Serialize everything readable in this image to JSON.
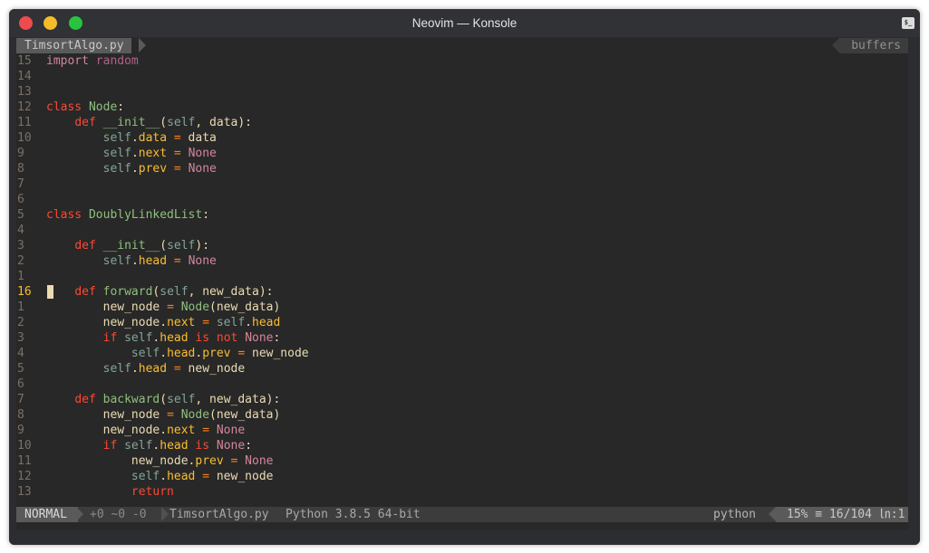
{
  "window": {
    "title": "Neovim — Konsole",
    "terminal_icon": "$_",
    "colors": {
      "close": "#ee4b4f",
      "minimize": "#f4bc28",
      "maximize": "#2ac33f"
    }
  },
  "tabline": {
    "active_tab": "TimsortAlgo.py",
    "buffers_label": "buffers"
  },
  "code": {
    "lines": [
      {
        "n": "15",
        "tokens": [
          [
            "kw2",
            "import"
          ],
          [
            "id",
            " "
          ],
          [
            "mod",
            "random"
          ]
        ]
      },
      {
        "n": "14",
        "tokens": []
      },
      {
        "n": "13",
        "tokens": []
      },
      {
        "n": "12",
        "tokens": [
          [
            "kw",
            "class"
          ],
          [
            "id",
            " "
          ],
          [
            "cls",
            "Node"
          ],
          [
            "id",
            ":"
          ]
        ]
      },
      {
        "n": "11",
        "tokens": [
          [
            "id",
            "    "
          ],
          [
            "kw",
            "def"
          ],
          [
            "id",
            " "
          ],
          [
            "cls",
            "__init__"
          ],
          [
            "id",
            "("
          ],
          [
            "self",
            "self"
          ],
          [
            "id",
            ", data):"
          ]
        ]
      },
      {
        "n": "10",
        "tokens": [
          [
            "id",
            "        "
          ],
          [
            "self",
            "self"
          ],
          [
            "id",
            "."
          ],
          [
            "attr",
            "data"
          ],
          [
            "id",
            " "
          ],
          [
            "op",
            "="
          ],
          [
            "id",
            " data"
          ]
        ]
      },
      {
        "n": "9",
        "tokens": [
          [
            "id",
            "        "
          ],
          [
            "self",
            "self"
          ],
          [
            "id",
            "."
          ],
          [
            "attr",
            "next"
          ],
          [
            "id",
            " "
          ],
          [
            "op",
            "="
          ],
          [
            "id",
            " "
          ],
          [
            "pink",
            "None"
          ]
        ]
      },
      {
        "n": "8",
        "tokens": [
          [
            "id",
            "        "
          ],
          [
            "self",
            "self"
          ],
          [
            "id",
            "."
          ],
          [
            "attr",
            "prev"
          ],
          [
            "id",
            " "
          ],
          [
            "op",
            "="
          ],
          [
            "id",
            " "
          ],
          [
            "pink",
            "None"
          ]
        ]
      },
      {
        "n": "7",
        "tokens": []
      },
      {
        "n": "6",
        "tokens": []
      },
      {
        "n": "5",
        "tokens": [
          [
            "kw",
            "class"
          ],
          [
            "id",
            " "
          ],
          [
            "cls",
            "DoublyLinkedList"
          ],
          [
            "id",
            ":"
          ]
        ]
      },
      {
        "n": "4",
        "tokens": []
      },
      {
        "n": "3",
        "tokens": [
          [
            "id",
            "    "
          ],
          [
            "kw",
            "def"
          ],
          [
            "id",
            " "
          ],
          [
            "cls",
            "__init__"
          ],
          [
            "id",
            "("
          ],
          [
            "self",
            "self"
          ],
          [
            "id",
            "):"
          ]
        ]
      },
      {
        "n": "2",
        "tokens": [
          [
            "id",
            "        "
          ],
          [
            "self",
            "self"
          ],
          [
            "id",
            "."
          ],
          [
            "attr",
            "head"
          ],
          [
            "id",
            " "
          ],
          [
            "op",
            "="
          ],
          [
            "id",
            " "
          ],
          [
            "pink",
            "None"
          ]
        ]
      },
      {
        "n": "1",
        "tokens": []
      },
      {
        "n": "16",
        "current": true,
        "tokens": [
          [
            "id",
            "    "
          ],
          [
            "kw",
            "def"
          ],
          [
            "id",
            " "
          ],
          [
            "cls",
            "forward"
          ],
          [
            "id",
            "("
          ],
          [
            "self",
            "self"
          ],
          [
            "id",
            ", new_data):"
          ]
        ]
      },
      {
        "n": "1",
        "tokens": [
          [
            "id",
            "        new_node "
          ],
          [
            "op",
            "="
          ],
          [
            "id",
            " "
          ],
          [
            "cls",
            "Node"
          ],
          [
            "id",
            "(new_data)"
          ]
        ]
      },
      {
        "n": "2",
        "tokens": [
          [
            "id",
            "        new_node."
          ],
          [
            "attr",
            "next"
          ],
          [
            "id",
            " "
          ],
          [
            "op",
            "="
          ],
          [
            "id",
            " "
          ],
          [
            "self",
            "self"
          ],
          [
            "id",
            "."
          ],
          [
            "attr",
            "head"
          ]
        ]
      },
      {
        "n": "3",
        "tokens": [
          [
            "id",
            "        "
          ],
          [
            "kw",
            "if"
          ],
          [
            "id",
            " "
          ],
          [
            "self",
            "self"
          ],
          [
            "id",
            "."
          ],
          [
            "attr",
            "head"
          ],
          [
            "id",
            " "
          ],
          [
            "kw",
            "is"
          ],
          [
            "id",
            " "
          ],
          [
            "kw",
            "not"
          ],
          [
            "id",
            " "
          ],
          [
            "pink",
            "None"
          ],
          [
            "id",
            ":"
          ]
        ]
      },
      {
        "n": "4",
        "tokens": [
          [
            "id",
            "            "
          ],
          [
            "self",
            "self"
          ],
          [
            "id",
            "."
          ],
          [
            "attr",
            "head"
          ],
          [
            "id",
            "."
          ],
          [
            "attr",
            "prev"
          ],
          [
            "id",
            " "
          ],
          [
            "op",
            "="
          ],
          [
            "id",
            " new_node"
          ]
        ]
      },
      {
        "n": "5",
        "tokens": [
          [
            "id",
            "        "
          ],
          [
            "self",
            "self"
          ],
          [
            "id",
            "."
          ],
          [
            "attr",
            "head"
          ],
          [
            "id",
            " "
          ],
          [
            "op",
            "="
          ],
          [
            "id",
            " new_node"
          ]
        ]
      },
      {
        "n": "6",
        "tokens": []
      },
      {
        "n": "7",
        "tokens": [
          [
            "id",
            "    "
          ],
          [
            "kw",
            "def"
          ],
          [
            "id",
            " "
          ],
          [
            "cls",
            "backward"
          ],
          [
            "id",
            "("
          ],
          [
            "self",
            "self"
          ],
          [
            "id",
            ", new_data):"
          ]
        ]
      },
      {
        "n": "8",
        "tokens": [
          [
            "id",
            "        new_node "
          ],
          [
            "op",
            "="
          ],
          [
            "id",
            " "
          ],
          [
            "cls",
            "Node"
          ],
          [
            "id",
            "(new_data)"
          ]
        ]
      },
      {
        "n": "9",
        "tokens": [
          [
            "id",
            "        new_node."
          ],
          [
            "attr",
            "next"
          ],
          [
            "id",
            " "
          ],
          [
            "op",
            "="
          ],
          [
            "id",
            " "
          ],
          [
            "pink",
            "None"
          ]
        ]
      },
      {
        "n": "10",
        "tokens": [
          [
            "id",
            "        "
          ],
          [
            "kw",
            "if"
          ],
          [
            "id",
            " "
          ],
          [
            "self",
            "self"
          ],
          [
            "id",
            "."
          ],
          [
            "attr",
            "head"
          ],
          [
            "id",
            " "
          ],
          [
            "kw",
            "is"
          ],
          [
            "id",
            " "
          ],
          [
            "pink",
            "None"
          ],
          [
            "id",
            ":"
          ]
        ]
      },
      {
        "n": "11",
        "tokens": [
          [
            "id",
            "            new_node."
          ],
          [
            "attr",
            "prev"
          ],
          [
            "id",
            " "
          ],
          [
            "op",
            "="
          ],
          [
            "id",
            " "
          ],
          [
            "pink",
            "None"
          ]
        ]
      },
      {
        "n": "12",
        "tokens": [
          [
            "id",
            "            "
          ],
          [
            "self",
            "self"
          ],
          [
            "id",
            "."
          ],
          [
            "attr",
            "head"
          ],
          [
            "id",
            " "
          ],
          [
            "op",
            "="
          ],
          [
            "id",
            " new_node"
          ]
        ]
      },
      {
        "n": "13",
        "tokens": [
          [
            "id",
            "            "
          ],
          [
            "kw",
            "return"
          ]
        ]
      }
    ]
  },
  "statusline": {
    "mode": "NORMAL",
    "git_hunks": "+0 ~0 -0",
    "filename": "TimsortAlgo.py",
    "python_version": "Python 3.8.5 64-bit",
    "filetype": "python",
    "position": "15% ≡ 16/104 ㏑:1"
  }
}
